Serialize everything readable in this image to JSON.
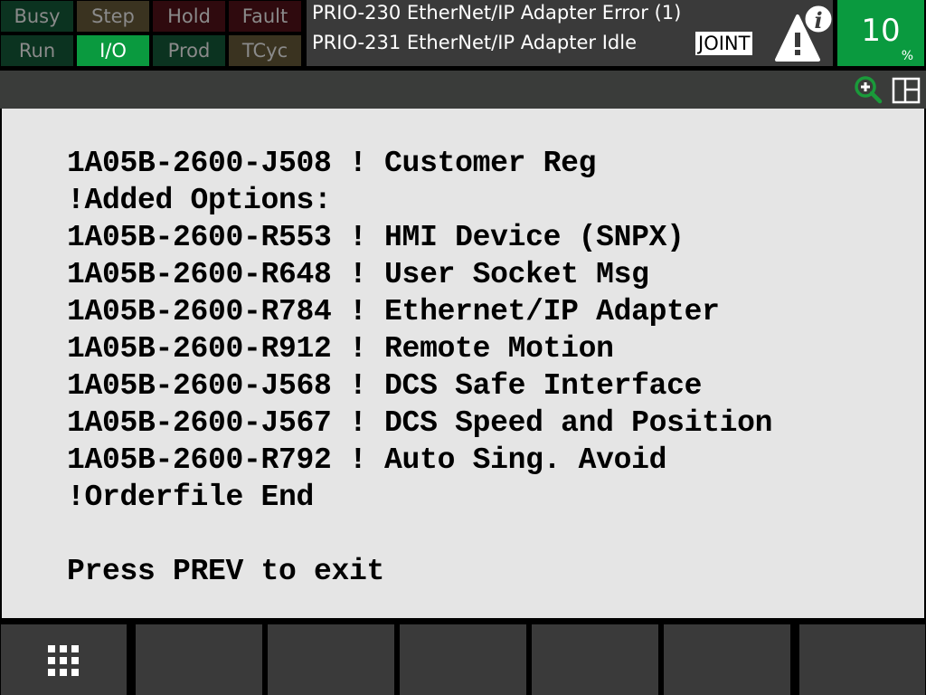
{
  "status_buttons": [
    {
      "label": "Busy",
      "state": "off",
      "color": "#0b3320"
    },
    {
      "label": "Step",
      "state": "off",
      "color": "#3a3320"
    },
    {
      "label": "Hold",
      "state": "off",
      "color": "#2f0a0e"
    },
    {
      "label": "Fault",
      "state": "off",
      "color": "#2f0a0e"
    },
    {
      "label": "Run",
      "state": "off",
      "color": "#0b3320"
    },
    {
      "label": "I/O",
      "state": "on",
      "color": "#0a9a3f"
    },
    {
      "label": "Prod",
      "state": "off",
      "color": "#0b3320"
    },
    {
      "label": "TCyc",
      "state": "off",
      "color": "#3a3320"
    }
  ],
  "alarm_panel": {
    "messages": [
      "PRIO-230 EtherNet/IP Adapter Error (1)",
      "PRIO-231 EtherNet/IP Adapter Idle"
    ],
    "coord_system": "JOINT",
    "icon": "warning-info-icon"
  },
  "override": {
    "value": "10",
    "unit": "%",
    "color": "#0a9a3f"
  },
  "toolbar": {
    "icons": [
      "zoom-in-icon",
      "split-layout-icon"
    ],
    "zoom_icon_color": "#1a9a3a"
  },
  "content": {
    "lines": [
      "1A05B-2600-J508 ! Customer Reg",
      "!Added Options:",
      "1A05B-2600-R553 ! HMI Device (SNPX)",
      "1A05B-2600-R648 ! User Socket Msg",
      "1A05B-2600-R784 ! Ethernet/IP Adapter",
      "1A05B-2600-R912 ! Remote Motion",
      "1A05B-2600-J568 ! DCS Safe Interface",
      "1A05B-2600-J567 ! DCS Speed and Position",
      "1A05B-2600-R792 ! Auto Sing. Avoid",
      "!Orderfile End",
      "",
      "Press PREV to exit"
    ]
  },
  "function_keys": [
    {
      "label": "",
      "icon": "menu-grid-icon"
    },
    {
      "label": ""
    },
    {
      "label": ""
    },
    {
      "label": ""
    },
    {
      "label": ""
    },
    {
      "label": ""
    },
    {
      "label": ""
    }
  ]
}
